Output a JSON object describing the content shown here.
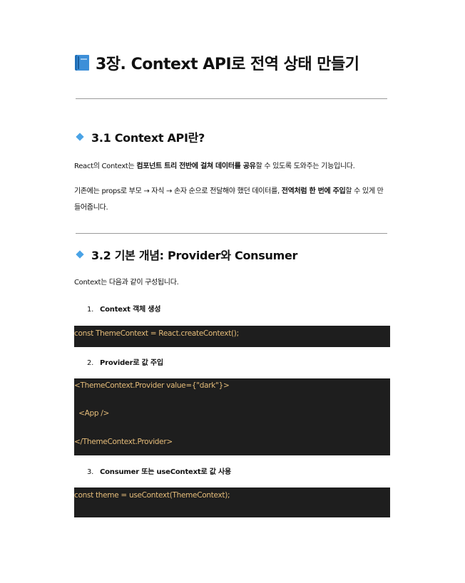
{
  "title": {
    "icon": "blue-book-icon",
    "text": "3장. Context API로 전역 상태 만들기"
  },
  "section1": {
    "icon": "blue-diamond-icon",
    "heading": "3.1 Context API란?",
    "p1": {
      "a": "React의 Context는 ",
      "b": "컴포넌트 트리 전반에 걸쳐 데이터를 공유",
      "c": "할 수 있도록 도와주는 기능입니다."
    },
    "p2": {
      "a": "기존에는 props로 부모 → 자식 → 손자 순으로 전달해야 했던 데이터를, ",
      "b": "전역처럼 한 번에 주입",
      "c": "할 수 있게 만들어줍니다."
    }
  },
  "section2": {
    "icon": "blue-diamond-icon",
    "heading": "3.2 기본 개념: Provider와 Consumer",
    "intro": "Context는 다음과 같이 구성됩니다.",
    "steps": [
      {
        "num": "1.",
        "label": "Context 객체 생성"
      },
      {
        "num": "2.",
        "label": "Provider로 값 주입"
      },
      {
        "num": "3.",
        "label": "Consumer 또는 useContext로 값 사용"
      }
    ],
    "code": {
      "block1": [
        "const ThemeContext = React.createContext();"
      ],
      "block2": [
        "<ThemeContext.Provider value={\"dark\"}>",
        "  <App />",
        "</ThemeContext.Provider>"
      ],
      "block3": [
        "const theme = useContext(ThemeContext);"
      ]
    }
  },
  "colors": {
    "code_bg": "#1e1e1e",
    "code_text": "#e6bd7a",
    "accent": "#4aa3e6",
    "rule": "#9a9a9a"
  }
}
